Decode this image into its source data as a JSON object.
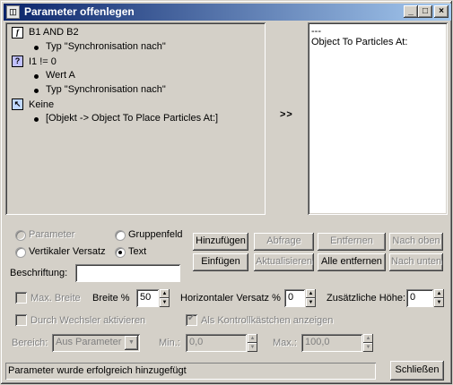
{
  "window": {
    "title": "Parameter offenlegen",
    "controls": {
      "minimize": "_",
      "maximize": "□",
      "close": "×"
    }
  },
  "tree": {
    "nodes": [
      {
        "icon": "f",
        "icon_name": "function-icon",
        "label": "B1 AND B2",
        "children": [
          "Typ \"Synchronisation nach\""
        ]
      },
      {
        "icon": "?",
        "icon_name": "condition-icon",
        "label": "I1 != 0",
        "children": [
          "Wert A",
          "Typ \"Synchronisation nach\""
        ]
      },
      {
        "icon": "↖",
        "icon_name": "cursor-icon",
        "label": "Keine",
        "children": [
          "[Objekt -> Object To Place Particles At:]"
        ]
      }
    ]
  },
  "move_button": ">>",
  "output_list": [
    "---",
    "Object To Particles At:"
  ],
  "type_options": {
    "parameter": "Parameter",
    "gruppenfeld": "Gruppenfeld",
    "vertikaler_versatz": "Vertikaler Versatz",
    "text": "Text"
  },
  "beschriftung": {
    "label": "Beschriftung:",
    "value": ""
  },
  "buttons": {
    "hinzufuegen": "Hinzufügen",
    "einfuegen": "Einfügen",
    "abfrage": "Abfrage",
    "aktualisieren": "Aktualisieren",
    "entfernen": "Entfernen",
    "alle_entfernen": "Alle entfernen",
    "nach_oben": "Nach oben",
    "nach_unten": "Nach unten",
    "schliessen": "Schließen"
  },
  "row1": {
    "max_breite": "Max. Breite",
    "breite_label": "Breite %",
    "breite_value": "50",
    "hversatz_label": "Horizontaler Versatz %",
    "hversatz_value": "0",
    "zhoehe_label": "Zusätzliche Höhe:",
    "zhoehe_value": "0"
  },
  "row2": {
    "durch_wechsler": "Durch Wechsler aktivieren",
    "als_kontroll": "Als Kontrollkästchen anzeigen"
  },
  "row3": {
    "bereich_label": "Bereich:",
    "bereich_value": "Aus Parameter",
    "min_label": "Min.:",
    "min_value": "0,0",
    "max_label": "Max.:",
    "max_value": "100,0"
  },
  "status": "Parameter  wurde erfolgreich hinzugefügt"
}
